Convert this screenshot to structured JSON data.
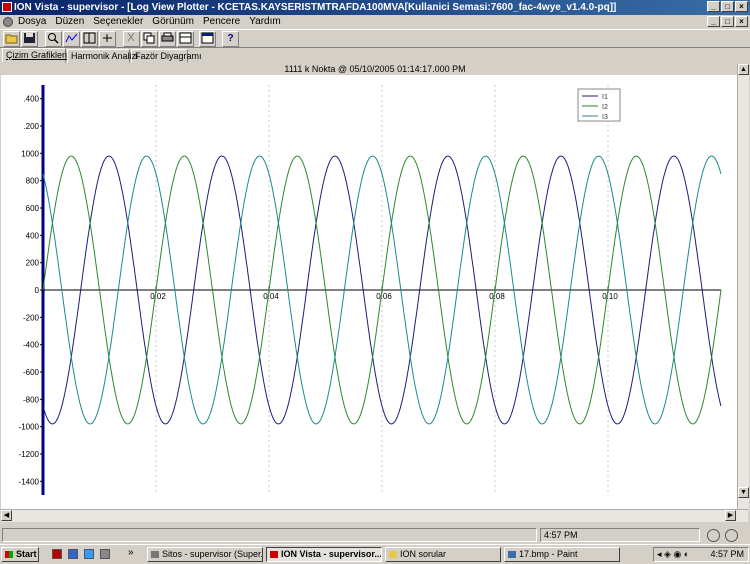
{
  "window": {
    "title": "ION Vista - supervisor - [Log View Plotter - KCETAS.KAYSERISTMTRAFDA100MVA[Kullanici Semasi:7600_fac-4wye_v1.4.0-pq]]"
  },
  "menu": [
    "Dosya",
    "Düzen",
    "Seçenekler",
    "Görünüm",
    "Pencere",
    "Yardım"
  ],
  "tabs": [
    "Çizim Grafikleri",
    "Harmonik Analizi",
    "Fazör Diyagramı"
  ],
  "plot_header": "1111 k Nokta @ 05/10/2005 01:14:17.000 PM",
  "chart_data": {
    "type": "line",
    "ylim": [
      -1500,
      1500
    ],
    "yticks": [
      1400,
      1200,
      1000,
      800,
      600,
      400,
      200,
      0,
      -200,
      -400,
      -600,
      -800,
      -1000,
      -1200,
      -1400
    ],
    "ytick_labels": [
      ".400",
      ".200",
      "1000",
      "800",
      "600",
      "400",
      "200",
      "0",
      "-200",
      "-400",
      "-600",
      "-800",
      "-1000",
      "-1200",
      "-1400"
    ],
    "xlim": [
      0,
      0.12
    ],
    "xticks": [
      0.02,
      0.04,
      0.06,
      0.08,
      0.1
    ],
    "xtick_labels": [
      "0.02",
      "0.04",
      "0.06",
      "0.08",
      "0.10"
    ],
    "legend_position": "top-right",
    "grid": true,
    "series": [
      {
        "name": "I1",
        "color": "#1c1c7a",
        "amplitude": 980,
        "frequency_hz": 50,
        "phase_deg": -120
      },
      {
        "name": "I2",
        "color": "#2a8a2a",
        "amplitude": 980,
        "frequency_hz": 50,
        "phase_deg": 0
      },
      {
        "name": "I3",
        "color": "#1a8a8a",
        "amplitude": 980,
        "frequency_hz": 50,
        "phase_deg": 120
      }
    ]
  },
  "status": {
    "time": "4:57 PM"
  },
  "taskbar": {
    "start": "Start",
    "tasks": [
      "Sitos - supervisor (Super...",
      "ION Vista - supervisor...",
      "ION sorular",
      "17.bmp - Paint"
    ],
    "active_task_index": 1,
    "tray_time": "4:57 PM"
  },
  "colors": {
    "titlebar_start": "#0a246a",
    "titlebar_end": "#3a6ea5",
    "face": "#d4d0c8"
  }
}
